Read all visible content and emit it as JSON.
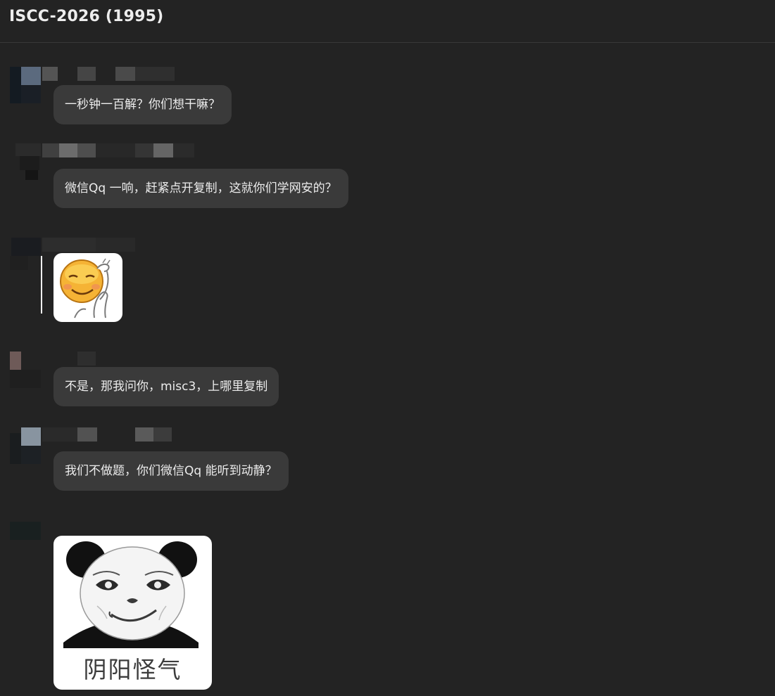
{
  "window": {
    "title": "ISCC-2026 (1995)"
  },
  "messages": [
    {
      "type": "text",
      "text": "一秒钟一百解？你们想干嘛？"
    },
    {
      "type": "text",
      "text": "微信Qq 一响，赶紧点开复制，这就你们学网安的？"
    },
    {
      "type": "sticker",
      "sticker": "smiling-emoji"
    },
    {
      "type": "text",
      "text": "不是，那我问你，misc3，上哪里复制"
    },
    {
      "type": "text",
      "text": "我们不做题，你们微信Qq 能听到动静？"
    },
    {
      "type": "sticker",
      "sticker": "panda-meme",
      "caption": "阴阳怪气"
    }
  ]
}
